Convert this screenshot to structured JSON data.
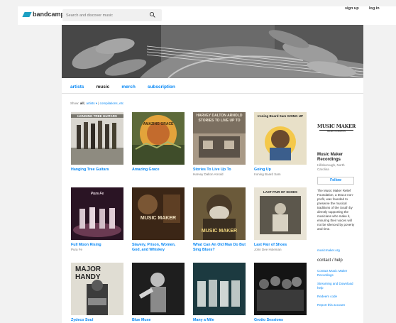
{
  "header": {
    "logo_text": "bandcamp",
    "search_placeholder": "Search and discover music",
    "signup": "sign up",
    "login": "log in"
  },
  "nav": {
    "tabs": [
      "artists",
      "music",
      "merch",
      "subscription"
    ],
    "active": "music"
  },
  "filter": {
    "prefix": "Show:",
    "all": "all",
    "artists": "artists ▾",
    "compilations": "compilations, etc"
  },
  "albums": [
    {
      "title": "Hanging Tree Guitars",
      "artist": "",
      "cover_text": "HANGING TREE GUITARS"
    },
    {
      "title": "Amazing Grace",
      "artist": "",
      "cover_text": "AMAZING GRACE"
    },
    {
      "title": "Stories To Live Up To",
      "artist": "Harvey Dalton Arnold",
      "cover_text": "HARVEY DALTON ARNOLD STORIES TO LIVE UP TO"
    },
    {
      "title": "Going Up",
      "artist": "Ironing Board Sam",
      "cover_text": "Ironing Board Sam GOING UP"
    },
    {
      "title": "Full Moon Rising",
      "artist": "Pura Fe",
      "cover_text": "Pura Fe"
    },
    {
      "title": "Slavery, Prison, Women, God, and Whiskey",
      "artist": "",
      "cover_text": "MUSIC MAKER"
    },
    {
      "title": "What Can An Old Man Do But Sing Blues?",
      "artist": "",
      "cover_text": "MUSIC MAKER"
    },
    {
      "title": "Last Pair of Shoes",
      "artist": "John Dee Holeman",
      "cover_text": "LAST PAIR OF SHOES"
    },
    {
      "title": "Zydeco Soul",
      "artist": "",
      "cover_text": "MAJOR HANDY"
    },
    {
      "title": "Blue Muse",
      "artist": "",
      "cover_text": ""
    },
    {
      "title": "Many a Mile",
      "artist": "",
      "cover_text": ""
    },
    {
      "title": "Grotto Sessions",
      "artist": "",
      "cover_text": ""
    }
  ],
  "sidebar": {
    "logo_text": "MUSIC MAKER",
    "logo_sub": "RELIEF FOUNDATION",
    "label_name": "Music Maker Recordings",
    "location": "Hillsborough, North Carolina",
    "follow": "Follow",
    "bio": "The Music Maker Relief Foundation, a 501c3 non-profit, was founded to preserve the musical traditions of the South by directly supporting the musicians who make it, ensuring their voices will not be silenced by poverty and time.",
    "website": "musicmaker.org",
    "contact_heading": "contact / help",
    "links": [
      "Contact Music Maker Recordings",
      "Streaming and Download help",
      "Redeem code",
      "Report this account"
    ]
  },
  "colors": {
    "link": "#0687f5",
    "logo": "#1da0c3"
  }
}
